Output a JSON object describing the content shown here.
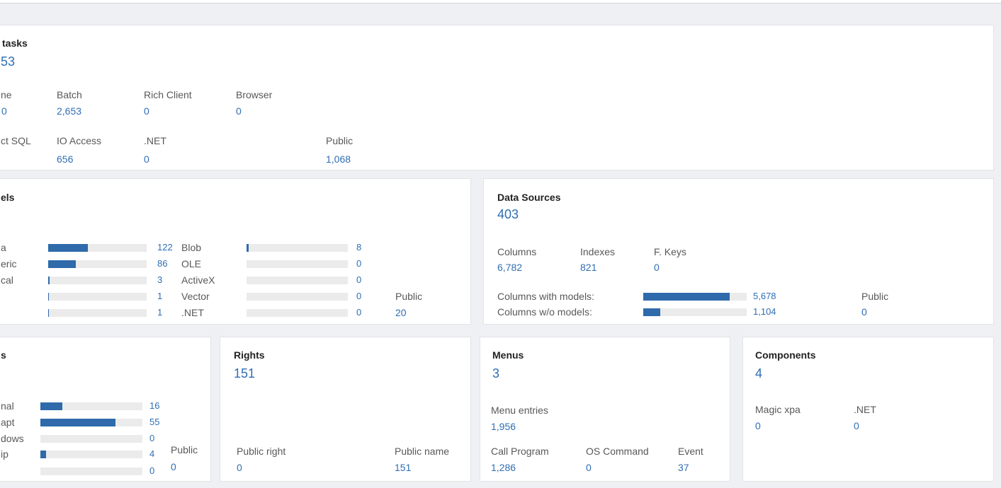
{
  "colors": {
    "page_background": "#eff0f3",
    "panel_background": "#ffffff",
    "value_blue": "#2f6eb4",
    "bar_fill": "#2f6aab",
    "bar_track": "#ebebeb"
  },
  "tasks": {
    "title": "tasks",
    "total": "53",
    "row1": [
      {
        "label": "ne",
        "value": "0"
      },
      {
        "label": "Batch",
        "value": "2,653"
      },
      {
        "label": "Rich Client",
        "value": "0"
      },
      {
        "label": "Browser",
        "value": "0"
      }
    ],
    "row2": [
      {
        "label": "ct SQL"
      },
      {
        "label": "IO Access",
        "value": "656"
      },
      {
        "label": ".NET",
        "value": "0"
      },
      {
        "label": "Public",
        "value": "1,068"
      }
    ]
  },
  "models": {
    "title": "els",
    "left_rows": [
      {
        "label": "a",
        "value": "122",
        "fill": 0.4
      },
      {
        "label": "eric",
        "value": "86",
        "fill": 0.28
      },
      {
        "label": "cal",
        "value": "3",
        "fill": 0.015
      },
      {
        "value": "1",
        "fill": 0.008
      },
      {
        "value": "1",
        "fill": 0.008
      }
    ],
    "right_rows": [
      {
        "label": "Blob",
        "value": "8",
        "fill": 0.02
      },
      {
        "label": "OLE",
        "value": "0",
        "fill": 0
      },
      {
        "label": "ActiveX",
        "value": "0",
        "fill": 0
      },
      {
        "label": "Vector",
        "value": "0",
        "fill": 0
      },
      {
        "label": ".NET",
        "value": "0",
        "fill": 0
      }
    ],
    "public_label": "Public",
    "public_value": "20"
  },
  "data_sources": {
    "title": "Data Sources",
    "total": "403",
    "stats": [
      {
        "label": "Columns",
        "value": "6,782"
      },
      {
        "label": "Indexes",
        "value": "821"
      },
      {
        "label": "F. Keys",
        "value": "0"
      }
    ],
    "bars": [
      {
        "label": "Columns with models:",
        "value": "5,678",
        "fill": 0.837
      },
      {
        "label": "Columns w/o models:",
        "value": "1,104",
        "fill": 0.163
      }
    ],
    "public_label": "Public",
    "public_value": "0"
  },
  "forms": {
    "title": "s",
    "rows": [
      {
        "label": "nal",
        "value": "16",
        "fill": 0.213
      },
      {
        "label": "apt",
        "value": "55",
        "fill": 0.733
      },
      {
        "label": "dows",
        "value": "0",
        "fill": 0
      },
      {
        "label": "ip",
        "value": "4",
        "fill": 0.053
      },
      {
        "value": "0",
        "fill": 0
      }
    ],
    "public_label": "Public",
    "public_value": "0"
  },
  "rights": {
    "title": "Rights",
    "total": "151",
    "public_right_label": "Public right",
    "public_right_value": "0",
    "public_name_label": "Public name",
    "public_name_value": "151"
  },
  "menus": {
    "title": "Menus",
    "total": "3",
    "entries_label": "Menu entries",
    "entries_value": "1,956",
    "call_program_label": "Call Program",
    "call_program_value": "1,286",
    "os_command_label": "OS Command",
    "os_command_value": "0",
    "event_label": "Event",
    "event_value": "37"
  },
  "components": {
    "title": "Components",
    "total": "4",
    "magic_label": "Magic xpa",
    "magic_value": "0",
    "net_label": ".NET",
    "net_value": "0"
  }
}
